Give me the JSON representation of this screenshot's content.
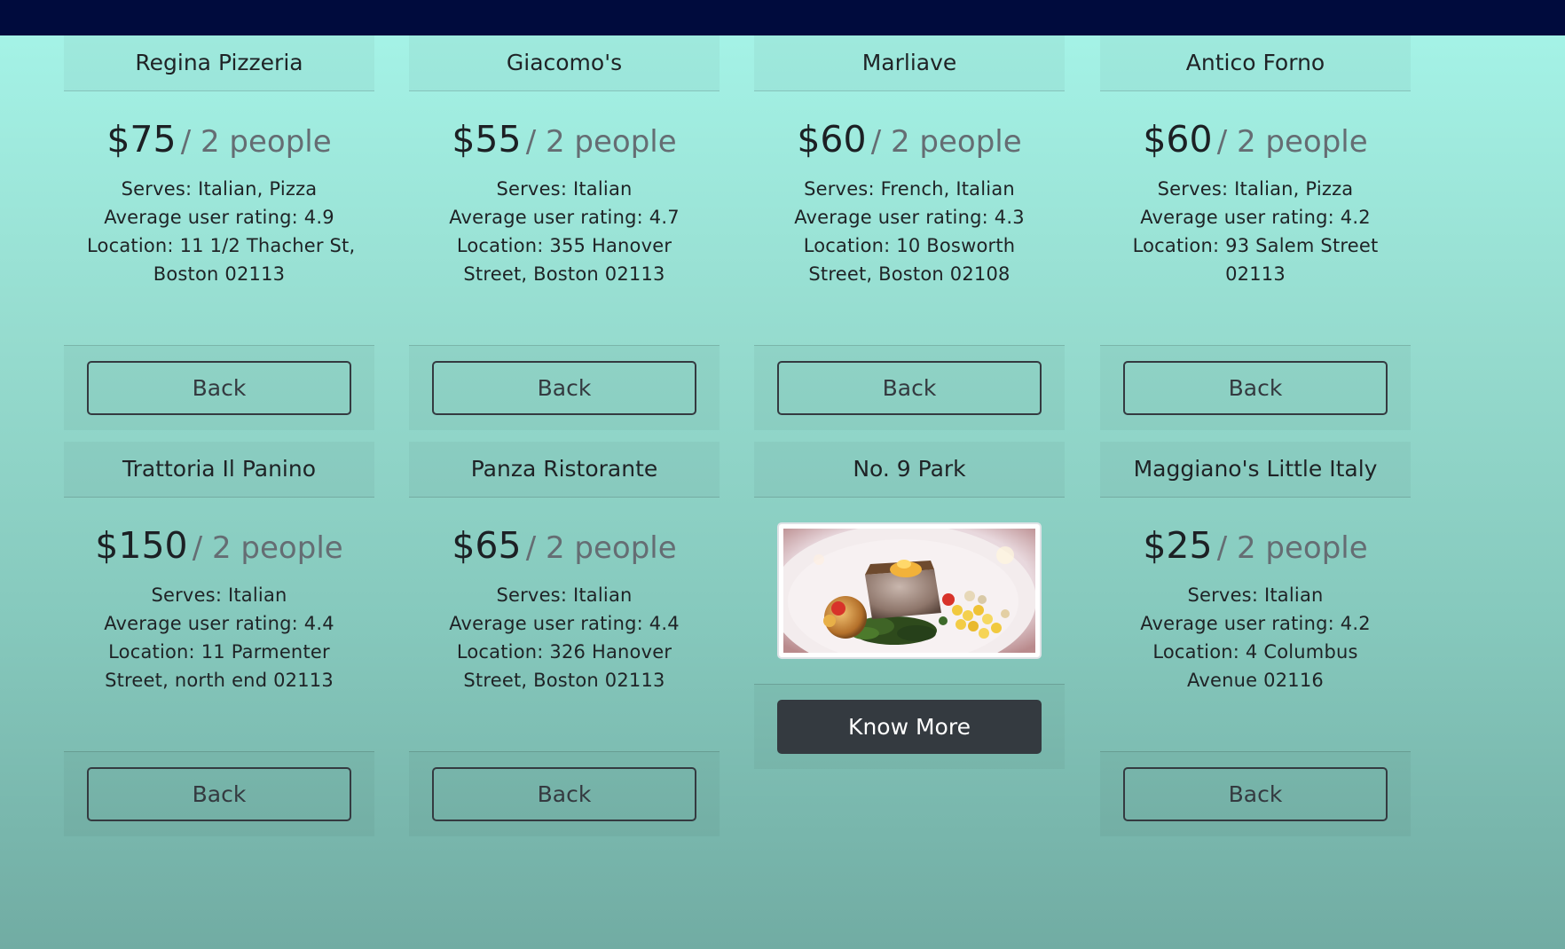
{
  "colors": {
    "topbar": "#000b3d",
    "button_outline": "#343a40",
    "button_dark": "#343a40",
    "background_top": "#a6f5e9",
    "background_bottom": "#71aca3"
  },
  "restaurants": [
    {
      "name": "Regina Pizzeria",
      "price": "$75",
      "price_unit": "/ 2 people",
      "serves": "Serves: Italian, Pizza",
      "rating": "Average user rating: 4.9",
      "location_line1": "Location: 11 1/2 Thacher St,",
      "location_line2": "Boston 02113",
      "button_label": "Back"
    },
    {
      "name": "Giacomo's",
      "price": "$55",
      "price_unit": "/ 2 people",
      "serves": "Serves: Italian",
      "rating": "Average user rating: 4.7",
      "location_line1": "Location: 355 Hanover",
      "location_line2": "Street, Boston 02113",
      "button_label": "Back"
    },
    {
      "name": "Marliave",
      "price": "$60",
      "price_unit": "/ 2 people",
      "serves": "Serves: French, Italian",
      "rating": "Average user rating: 4.3",
      "location_line1": "Location: 10 Bosworth",
      "location_line2": "Street, Boston 02108",
      "button_label": "Back"
    },
    {
      "name": "Antico Forno",
      "price": "$60",
      "price_unit": "/ 2 people",
      "serves": "Serves: Italian, Pizza",
      "rating": "Average user rating: 4.2",
      "location_line1": "Location: 93 Salem Street",
      "location_line2": "02113",
      "button_label": "Back"
    },
    {
      "name": "Trattoria Il Panino",
      "price": "$150",
      "price_unit": "/ 2 people",
      "serves": "Serves: Italian",
      "rating": "Average user rating: 4.4",
      "location_line1": "Location: 11 Parmenter",
      "location_line2": "Street, north end 02113",
      "button_label": "Back"
    },
    {
      "name": "Panza Ristorante",
      "price": "$65",
      "price_unit": "/ 2 people",
      "serves": "Serves: Italian",
      "rating": "Average user rating: 4.4",
      "location_line1": "Location: 326 Hanover",
      "location_line2": "Street, Boston 02113",
      "button_label": "Back"
    },
    {
      "name": "No. 9 Park",
      "button_label": "Know More"
    },
    {
      "name": "Maggiano's Little Italy",
      "price": "$25",
      "price_unit": "/ 2 people",
      "serves": "Serves: Italian",
      "rating": "Average user rating: 4.2",
      "location_line1": "Location: 4 Columbus",
      "location_line2": "Avenue 02116",
      "button_label": "Back"
    }
  ]
}
